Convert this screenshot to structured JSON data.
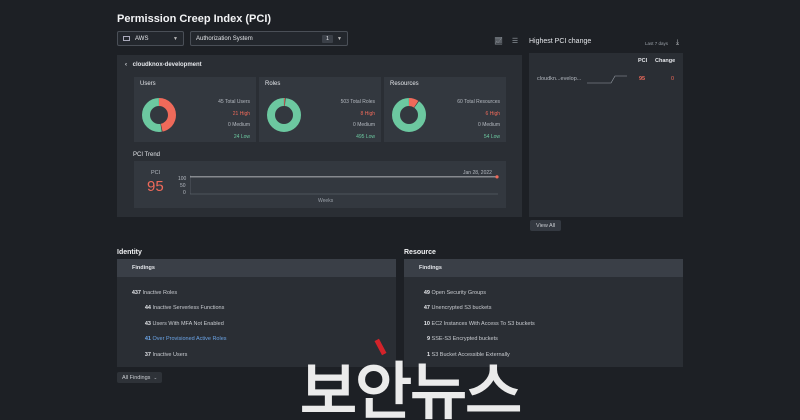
{
  "page": {
    "title": "Permission Creep Index (PCI)"
  },
  "filters": {
    "cloud": "AWS",
    "system_label": "Authorization System",
    "system_count": "1"
  },
  "breadcrumb": {
    "label": "cloudknox-development"
  },
  "cards": [
    {
      "title": "Users",
      "total": "45 Total Users",
      "high": "21 High",
      "medium": "0 Medium",
      "low": "24 Low",
      "fractions": {
        "high": 0.47,
        "medium": 0,
        "low": 0.53
      }
    },
    {
      "title": "Roles",
      "total": "503 Total Roles",
      "high": "8 High",
      "medium": "0 Medium",
      "low": "495 Low",
      "fractions": {
        "high": 0.016,
        "medium": 0,
        "low": 0.984
      }
    },
    {
      "title": "Resources",
      "total": "60 Total Resources",
      "high": "6 High",
      "medium": "0 Medium",
      "low": "54 Low",
      "fractions": {
        "high": 0.1,
        "medium": 0,
        "low": 0.9
      }
    }
  ],
  "trend": {
    "label": "PCI Trend",
    "pci_label": "PCI",
    "pci_value": "95",
    "date": "Jan 28, 2022",
    "yticks": [
      "100",
      "50",
      "0"
    ],
    "xlabel": "Weeks",
    "value": 95
  },
  "right_panel": {
    "title": "Highest PCI change",
    "period": "Last 7 days",
    "col_pci": "PCI",
    "col_change": "Change",
    "row": {
      "name": "cloudkn...evelop...",
      "pci": "95",
      "change": "0"
    },
    "view_all": "View All"
  },
  "identity": {
    "title": "Identity",
    "header": "Findings",
    "rows": [
      {
        "count": "437",
        "label": "Inactive Roles"
      },
      {
        "count": "44",
        "label": "Inactive Serverless Functions"
      },
      {
        "count": "43",
        "label": "Users With MFA Not Enabled"
      },
      {
        "count": "41",
        "label": "Over Provisioned Active Roles"
      },
      {
        "count": "37",
        "label": "Inactive Users"
      }
    ],
    "all_findings": "All Findings"
  },
  "resource": {
    "title": "Resource",
    "header": "Findings",
    "rows": [
      {
        "count": "49",
        "label": "Open Security Groups"
      },
      {
        "count": "47",
        "label": "Unencrypted S3 buckets"
      },
      {
        "count": "10",
        "label": "EC2 Instances With Access To S3 buckets"
      },
      {
        "count": "9",
        "label": "SSE-S3 Encrypted buckets"
      },
      {
        "count": "1",
        "label": "S3 Bucket Accessible Externally"
      }
    ]
  },
  "watermark": {
    "text": "보안뉴스"
  },
  "colors": {
    "high": "#ef6a5a",
    "low": "#6cc8a0",
    "bg": "#1d2025",
    "panel": "#2a2e34"
  }
}
